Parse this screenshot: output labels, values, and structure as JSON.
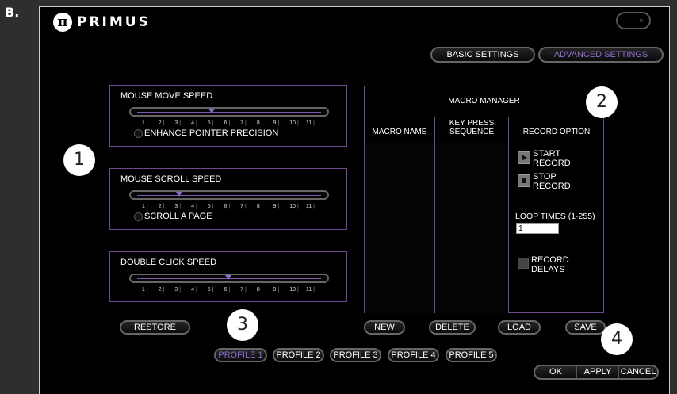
{
  "panel_label": "B.",
  "app": {
    "logo_glyph": "π",
    "logo_text": "PRIMUS",
    "window_controls": {
      "minimize": "–",
      "close": "×"
    }
  },
  "tabs": [
    {
      "label": "BASIC SETTINGS",
      "active": false
    },
    {
      "label": "ADVANCED SETTINGS",
      "active": true
    }
  ],
  "mouse_move": {
    "title": "MOUSE MOVE SPEED",
    "ticks": [
      "1",
      "2",
      "3",
      "4",
      "5",
      "6",
      "7",
      "8",
      "9",
      "10",
      "11"
    ],
    "option_label": "ENHANCE POINTER PRECISION",
    "level": 5
  },
  "mouse_scroll": {
    "title": "MOUSE SCROLL SPEED",
    "ticks": [
      "1",
      "2",
      "3",
      "4",
      "5",
      "6",
      "7",
      "8",
      "9",
      "10",
      "11"
    ],
    "option_label": "SCROLL A PAGE",
    "level": 3
  },
  "double_click": {
    "title": "DOUBLE CLICK SPEED",
    "ticks": [
      "1",
      "2",
      "3",
      "4",
      "5",
      "6",
      "7",
      "8",
      "9",
      "10",
      "11"
    ],
    "level": 6
  },
  "macro": {
    "title": "MACRO MANAGER",
    "col_name": "MACRO NAME",
    "col_keys_1": "KEY PRESS",
    "col_keys_2": "SEQUENCE",
    "col_option": "RECORD OPTION",
    "start_1": "START",
    "start_2": "RECORD",
    "stop_1": "STOP",
    "stop_2": "RECORD",
    "loop_label": "LOOP TIMES (1-255)",
    "loop_value": "1",
    "delays_1": "RECORD",
    "delays_2": "DELAYS"
  },
  "buttons": {
    "restore": "RESTORE",
    "new": "NEW",
    "delete": "DELETE",
    "load": "LOAD",
    "save": "SAVE",
    "ok": "OK",
    "apply": "APPLY",
    "cancel": "CANCEL"
  },
  "profiles": [
    "PROFILE 1",
    "PROFILE 2",
    "PROFILE 3",
    "PROFILE 4",
    "PROFILE 5"
  ],
  "active_profile": 0,
  "callouts": [
    "1",
    "2",
    "3",
    "4"
  ],
  "colors": {
    "accent": "#8e6cd0",
    "frame": "#6b4a8f",
    "background": "#000000"
  }
}
